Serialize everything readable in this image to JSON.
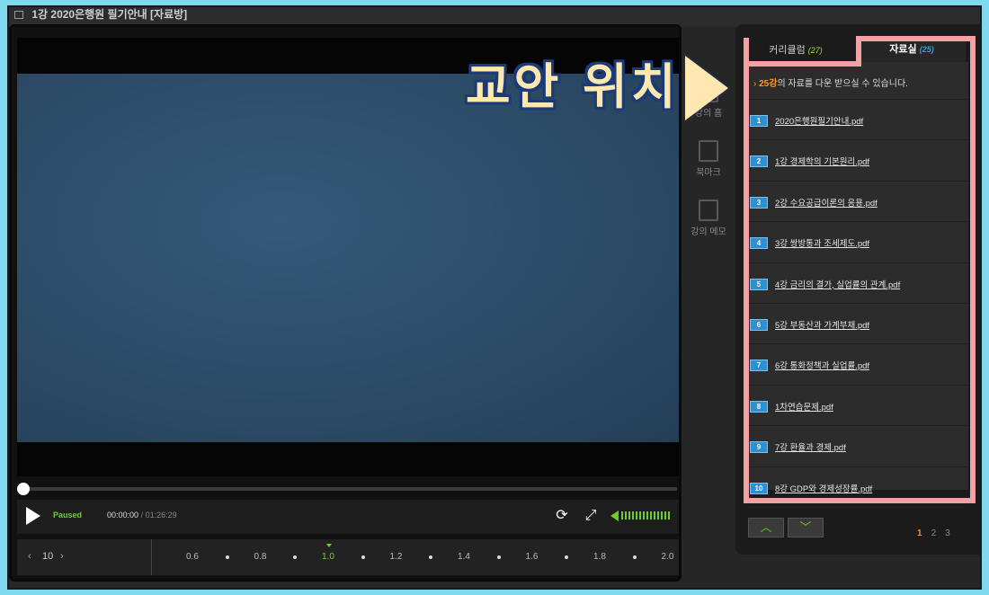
{
  "window": {
    "title": "1강  2020은행원 필기안내 [자료방]"
  },
  "player": {
    "status": "Paused",
    "current_time": "00:00:00",
    "time_sep": "/",
    "total_time": "01:26:29",
    "progress": 0.0,
    "step_label": "10",
    "step_left": "‹",
    "step_right": "›",
    "speeds": [
      "0.6",
      "0.8",
      "1.0",
      "1.2",
      "1.4",
      "1.6",
      "1.8",
      "2.0"
    ],
    "selected_speed": "1.0",
    "volume": 1.0
  },
  "sidetools": [
    {
      "label": "강의 홈",
      "icon": "home-icon"
    },
    {
      "label": "북마크",
      "icon": "bookmark-add-icon"
    },
    {
      "label": "강의 메모",
      "icon": "memo-icon"
    }
  ],
  "panel": {
    "tab_curriculum": {
      "label": "커리큘럼",
      "count": "(27)"
    },
    "tab_materials": {
      "label": "자료실",
      "count": "(25)"
    },
    "notice": {
      "highlight": "25강",
      "text": "의 자료를 다운 받으실 수 있습니다."
    },
    "files": [
      {
        "num": "1",
        "name": "2020은행원필기안내.pdf"
      },
      {
        "num": "2",
        "name": "1강 경제학의 기본원리.pdf"
      },
      {
        "num": "3",
        "name": "2강 수요공급이론의 응용.pdf"
      },
      {
        "num": "4",
        "name": "3강 쌍방통과 조세제도.pdf"
      },
      {
        "num": "5",
        "name": "4강 금리의 결가, 실업률의 관계.pdf"
      },
      {
        "num": "6",
        "name": "5강 부동산과 가계부채.pdf"
      },
      {
        "num": "7",
        "name": "6강 통화정책과 실업률.pdf"
      },
      {
        "num": "8",
        "name": "1차연습문제.pdf"
      },
      {
        "num": "9",
        "name": "7강 환율과 경제.pdf"
      },
      {
        "num": "10",
        "name": "8강 GDP와 경제성장률.pdf"
      }
    ],
    "pages": [
      "1",
      "2",
      "3"
    ],
    "current_page": "1",
    "nav_up": "︿",
    "nav_down": "﹀"
  },
  "annotation": {
    "text": "교안 위치"
  },
  "colors": {
    "accent_green": "#6fcf2a",
    "highlight_pink": "#f4a1a5",
    "tab_blue": "#29a8e0",
    "orange": "#ff9a1f"
  }
}
